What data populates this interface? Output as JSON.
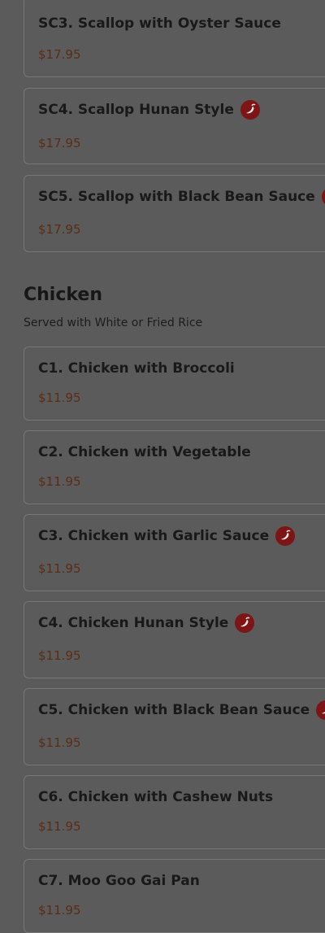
{
  "seafood_tail": [
    {
      "title": "SC3. Scallop with Oyster Sauce",
      "price": "$17.95",
      "spicy": false
    },
    {
      "title": "SC4. Scallop Hunan Style",
      "price": "$17.95",
      "spicy": true
    },
    {
      "title": "SC5. Scallop with Black Bean Sauce",
      "price": "$17.95",
      "spicy": true
    }
  ],
  "chicken": {
    "title": "Chicken",
    "subtitle": "Served with White or Fried Rice",
    "items": [
      {
        "title": "C1. Chicken with Broccoli",
        "price": "$11.95",
        "spicy": false
      },
      {
        "title": "C2. Chicken with Vegetable",
        "price": "$11.95",
        "spicy": false
      },
      {
        "title": "C3. Chicken with Garlic Sauce",
        "price": "$11.95",
        "spicy": true
      },
      {
        "title": "C4. Chicken Hunan Style",
        "price": "$11.95",
        "spicy": true
      },
      {
        "title": "C5. Chicken with Black Bean Sauce",
        "price": "$11.95",
        "spicy": true
      },
      {
        "title": "C6. Chicken with Cashew Nuts",
        "price": "$11.95",
        "spicy": false
      },
      {
        "title": "C7. Moo Goo Gai Pan",
        "price": "$11.95",
        "spicy": false
      }
    ]
  },
  "colors": {
    "spicy_badge": "#7d1416",
    "price": "#5a2d14",
    "overlay": "#5b5b5b"
  },
  "icons": {
    "spicy": "chili-pepper-icon"
  }
}
